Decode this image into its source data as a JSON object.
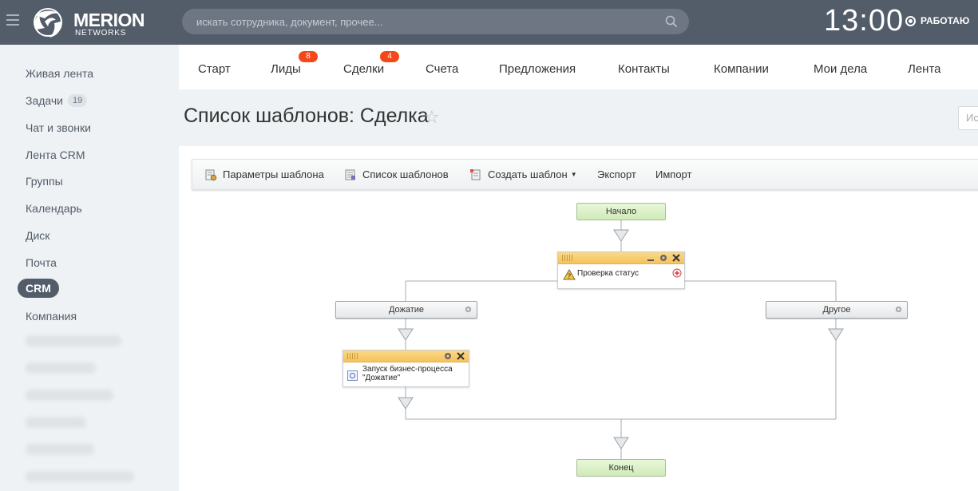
{
  "header": {
    "logo_title": "MERION",
    "logo_subtitle": "NETWORKS",
    "search_placeholder": "искать сотрудника, документ, прочее...",
    "clock": "13:00",
    "status": "РАБОТАЮ"
  },
  "sidebar": {
    "items": [
      {
        "label": "Живая лента"
      },
      {
        "label": "Задачи",
        "badge": "19"
      },
      {
        "label": "Чат и звонки"
      },
      {
        "label": "Лента CRM"
      },
      {
        "label": "Группы"
      },
      {
        "label": "Календарь"
      },
      {
        "label": "Диск"
      },
      {
        "label": "Почта"
      },
      {
        "label": "CRM"
      },
      {
        "label": "Компания"
      }
    ]
  },
  "topnav": {
    "items": [
      {
        "label": "Старт"
      },
      {
        "label": "Лиды",
        "badge": "8"
      },
      {
        "label": "Сделки",
        "badge": "4"
      },
      {
        "label": "Счета"
      },
      {
        "label": "Предложения"
      },
      {
        "label": "Контакты"
      },
      {
        "label": "Компании"
      },
      {
        "label": "Мои дела"
      },
      {
        "label": "Лента"
      }
    ]
  },
  "page": {
    "title": "Список шаблонов: Сделка",
    "search_partial": "Ис"
  },
  "toolbar": {
    "params": "Параметры шаблона",
    "list": "Список шаблонов",
    "create": "Создать шаблон",
    "export": "Экспорт",
    "import": "Импорт"
  },
  "diagram": {
    "start": "Начало",
    "condition": "Проверка статус",
    "branch_left": "Дожатие",
    "branch_right": "Другое",
    "action_line1": "Запуск бизнес-процесса",
    "action_line2": "\"Дожатие\"",
    "end": "Конец"
  },
  "colors": {
    "header_bg": "#535c69",
    "badge": "#f54819",
    "node_green": "#d9f0c4",
    "block_head": "#f7c96a"
  }
}
